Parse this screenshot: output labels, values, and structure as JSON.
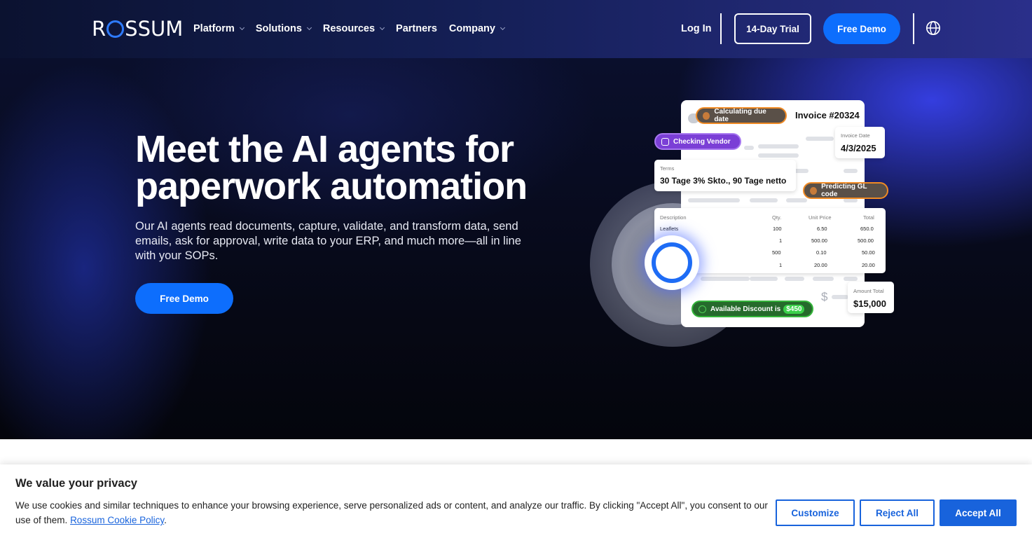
{
  "header": {
    "logo_text": "ROSSUM",
    "nav": [
      {
        "label": "Platform",
        "has_dropdown": true
      },
      {
        "label": "Solutions",
        "has_dropdown": true
      },
      {
        "label": "Resources",
        "has_dropdown": true
      },
      {
        "label": "Partners",
        "has_dropdown": false
      },
      {
        "label": "Company",
        "has_dropdown": true
      }
    ],
    "login_label": "Log In",
    "trial_label": "14-Day Trial",
    "demo_label": "Free Demo",
    "language_icon": "globe-icon"
  },
  "hero": {
    "title_line1": "Meet the AI agents for",
    "title_line2": "paperwork automation",
    "subtitle": "Our AI agents read documents, capture, validate, and transform data, send emails, ask for approval, write data to your ERP, and much more—all in line with your SOPs.",
    "cta_label": "Free Demo"
  },
  "illustration": {
    "invoice_number": "Invoice #20324",
    "pill_due_date": "Calculating due date",
    "pill_vendor": "Checking Vendor",
    "pill_gl": "Predicting GL code",
    "pill_discount": "Available Discount is",
    "discount_amount": "$450",
    "invoice_date_label": "Invoice Date",
    "invoice_date_value": "4/3/2025",
    "terms_label": "Terms",
    "terms_value": "30 Tage 3% Skto., 90 Tage netto",
    "table_headers": [
      "Description",
      "Qty.",
      "Unit Price",
      "Total"
    ],
    "table_rows": [
      {
        "desc": "Leaflets",
        "qty": "100",
        "unit": "6.50",
        "total": "650.0"
      },
      {
        "desc": "",
        "qty": "1",
        "unit": "500.00",
        "total": "500.00"
      },
      {
        "desc": "",
        "qty": "500",
        "unit": "0.10",
        "total": "50.00"
      },
      {
        "desc": "",
        "qty": "1",
        "unit": "20.00",
        "total": "20.00"
      }
    ],
    "amount_total_label": "Amount Total",
    "amount_total_value": "$15,000",
    "dollar_symbol": "$"
  },
  "cookie": {
    "title": "We value your privacy",
    "text": "We use cookies and similar techniques to enhance your browsing experience, serve personalized ads or content, and analyze our traffic. By clicking \"Accept All\", you consent to our use of them.",
    "policy_link": "Rossum Cookie Policy",
    "customize_label": "Customize",
    "reject_label": "Reject All",
    "accept_label": "Accept All"
  },
  "colors": {
    "brand_blue": "#0d6efd",
    "cookie_blue": "#1863dc",
    "header_bg": "#141f55"
  }
}
